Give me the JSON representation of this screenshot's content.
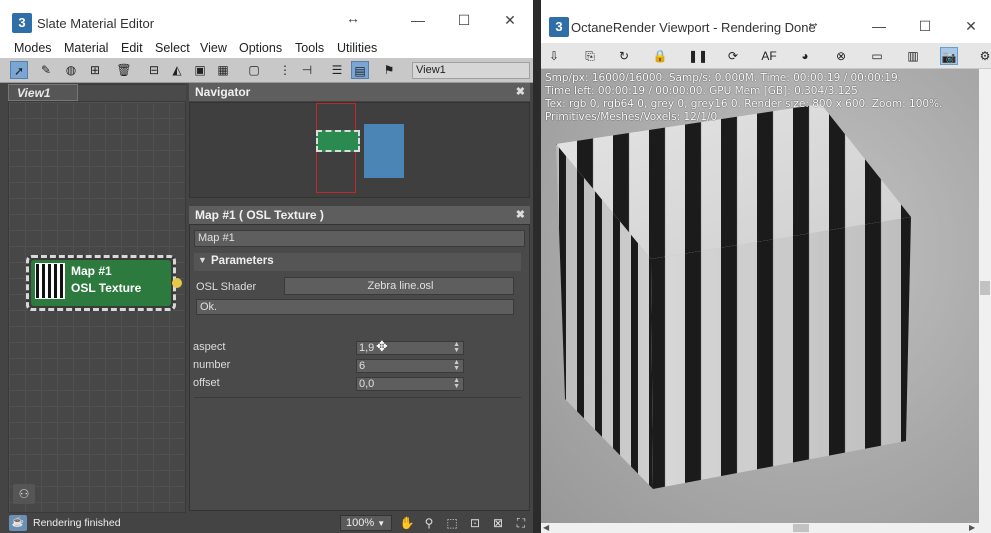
{
  "slate": {
    "title": "Slate Material Editor",
    "menus": [
      "Modes",
      "Material",
      "Edit",
      "Select",
      "View",
      "Options",
      "Tools",
      "Utilities"
    ],
    "view_dropdown": "View1",
    "view_tab": "View1",
    "node": {
      "name": "Map #1",
      "type": "OSL Texture"
    },
    "navigator_title": "Navigator",
    "map_panel_title": "Map #1  ( OSL Texture )",
    "map_name_field": "Map #1",
    "parameters_label": "Parameters",
    "osl_shader_label": "OSL Shader",
    "osl_shader_value": "Zebra line.osl",
    "status_field": "Ok.",
    "params": [
      {
        "label": "aspect",
        "value": "1,9"
      },
      {
        "label": "number",
        "value": "6"
      },
      {
        "label": "offset",
        "value": "0,0"
      }
    ],
    "status_text": "Rendering finished",
    "zoom": "100%"
  },
  "octane": {
    "title": "OctaneRender Viewport - Rendering Done",
    "info_lines": [
      "Smp/px: 16000/16000.   Samp/s: 0.000M.   Time: 00:00:19 / 00:00:19.",
      "Time left: 00:00:19 / 00:00:00.   GPU Mem [GB]: 0.304/3.125",
      "Tex: rgb 0, rgb64 0, grey 0, grey16 0.   Render size: 800 x 600.   Zoom: 100%.",
      "Primitives/Meshes/Voxels: 12/1/0"
    ]
  },
  "colors": {
    "node_green": "#2d7a3e",
    "nav_blue": "#4a85b5",
    "nav_red": "#c0282b",
    "toolbar_active": "#7aa6d6"
  }
}
